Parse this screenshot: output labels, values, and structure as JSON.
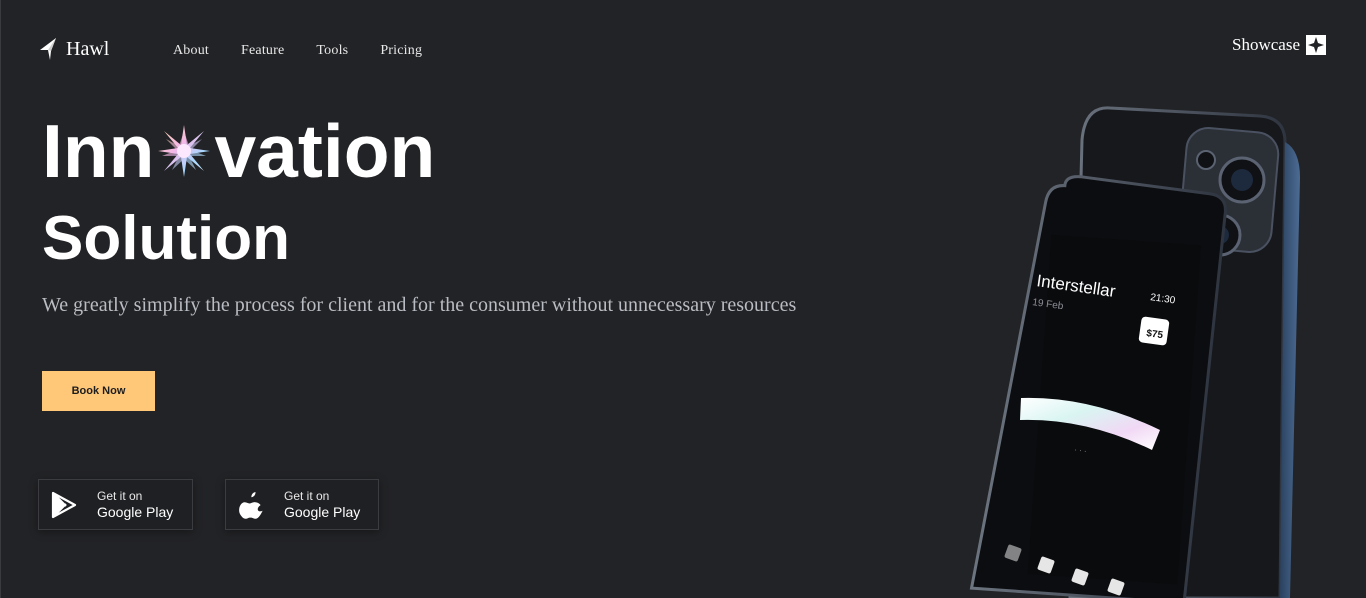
{
  "brand": {
    "name": "Hawl"
  },
  "nav": {
    "items": [
      "About",
      "Feature",
      "Tools",
      "Pricing"
    ]
  },
  "header": {
    "showcase_label": "Showcase"
  },
  "hero": {
    "title_part1": "Inn",
    "title_part2": "vation",
    "title_line2": "Solution",
    "subtitle": "We greatly simplify the process for client and for the consumer without unnecessary resources",
    "cta_label": "Book Now"
  },
  "stores": [
    {
      "small": "Get it on",
      "big": "Google Play",
      "icon": "google-play-icon"
    },
    {
      "small": "Get it on",
      "big": "Google Play",
      "icon": "apple-icon"
    }
  ],
  "phone_screen": {
    "app_name": "Interstellar",
    "date": "19 Feb",
    "time": "21:30",
    "price": "$75"
  },
  "colors": {
    "background": "#222326",
    "accent": "#ffc879",
    "muted_text": "#b9bcc2"
  }
}
